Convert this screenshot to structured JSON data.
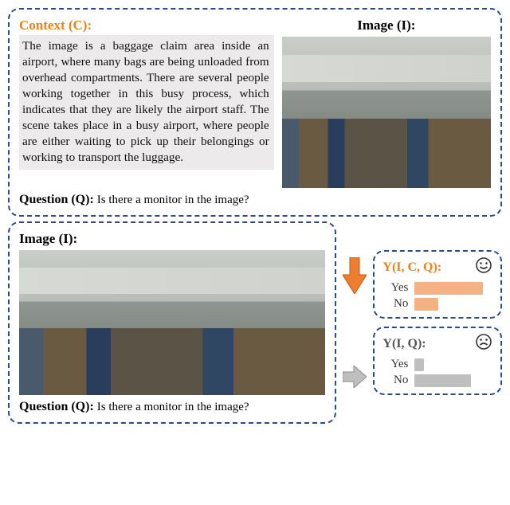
{
  "top": {
    "context_label": "Context (C):",
    "image_label": "Image (I):",
    "context_text": "The image is a baggage claim area inside an airport, where many bags are being unloaded from overhead compartments. There are several people working together in this busy process, which indicates that they are likely the airport staff. The scene takes place in a busy airport, where people are either waiting to pick up their belongings or working to transport the luggage.",
    "question_label": "Question (Q):",
    "question_text": "Is there a monitor in the image?"
  },
  "bottom": {
    "image_label": "Image (I):",
    "question_label": "Question (Q):",
    "question_text": "Is there a monitor in the image?"
  },
  "results": {
    "with_context": {
      "header": "Y(I, C, Q):",
      "rows": [
        {
          "label": "Yes",
          "value": 0.88
        },
        {
          "label": "No",
          "value": 0.3
        }
      ],
      "emotion": "happy"
    },
    "without_context": {
      "header": "Y(I, Q):",
      "rows": [
        {
          "label": "Yes",
          "value": 0.12
        },
        {
          "label": "No",
          "value": 0.72
        }
      ],
      "emotion": "sad"
    }
  },
  "chart_data": [
    {
      "type": "bar",
      "title": "Y(I, C, Q)",
      "categories": [
        "Yes",
        "No"
      ],
      "values": [
        0.88,
        0.3
      ],
      "xlabel": "",
      "ylabel": "",
      "ylim": [
        0,
        1
      ]
    },
    {
      "type": "bar",
      "title": "Y(I, Q)",
      "categories": [
        "Yes",
        "No"
      ],
      "values": [
        0.12,
        0.72
      ],
      "xlabel": "",
      "ylabel": "",
      "ylim": [
        0,
        1
      ]
    }
  ]
}
